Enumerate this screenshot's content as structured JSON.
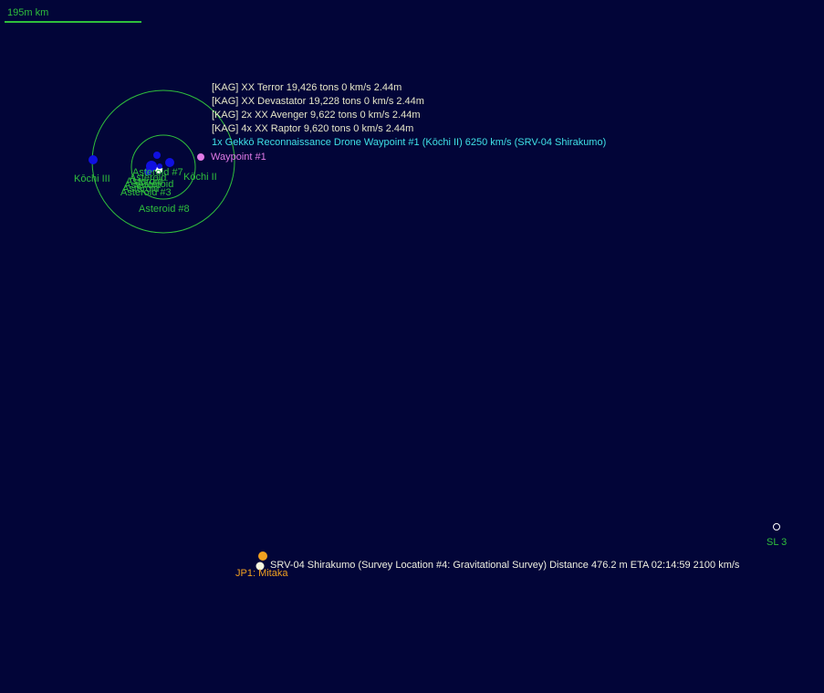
{
  "scale": {
    "label": "195m km"
  },
  "bodies": [
    {
      "label": "Kōchi III"
    },
    {
      "label": "Kōchi II"
    },
    {
      "label": "Asteroid #8"
    },
    {
      "label": "Asteroid #7"
    },
    {
      "label": "Asteroid #3"
    }
  ],
  "cluster_labels": [
    "Asteroid",
    "Asteroid",
    "Asteroid",
    "Asteroid",
    "Asteroid"
  ],
  "waypoint": {
    "label": "Waypoint #1"
  },
  "fleet_rows": [
    "[KAG]  XX Terror  19,426 tons    0 km/s  2.44m",
    "[KAG]  XX Devastator  19,228 tons    0 km/s  2.44m",
    "[KAG]  2x XX Avenger  9,622 tons    0 km/s  2.44m",
    "[KAG]  4x XX Raptor  9,620 tons    0 km/s  2.44m"
  ],
  "drone_row": "1x Gekkō Reconnaissance Drone  Waypoint #1  (Kōchi II)  6250 km/s (SRV-04 Shirakumo)",
  "survey_ship": "SRV-04 Shirakumo  (Survey Location #4: Gravitational Survey)   Distance 476.2 m   ETA 02:14:59   2100 km/s",
  "jump_point": {
    "label": "JP1: Mitaka"
  },
  "survey_location": {
    "label": "SL 3"
  },
  "colors": {
    "background": "#020538",
    "orbit": "#2fbf3c",
    "planet": "#1010e0",
    "waypoint": "#e07ae6",
    "jump_point": "#f0a020"
  }
}
